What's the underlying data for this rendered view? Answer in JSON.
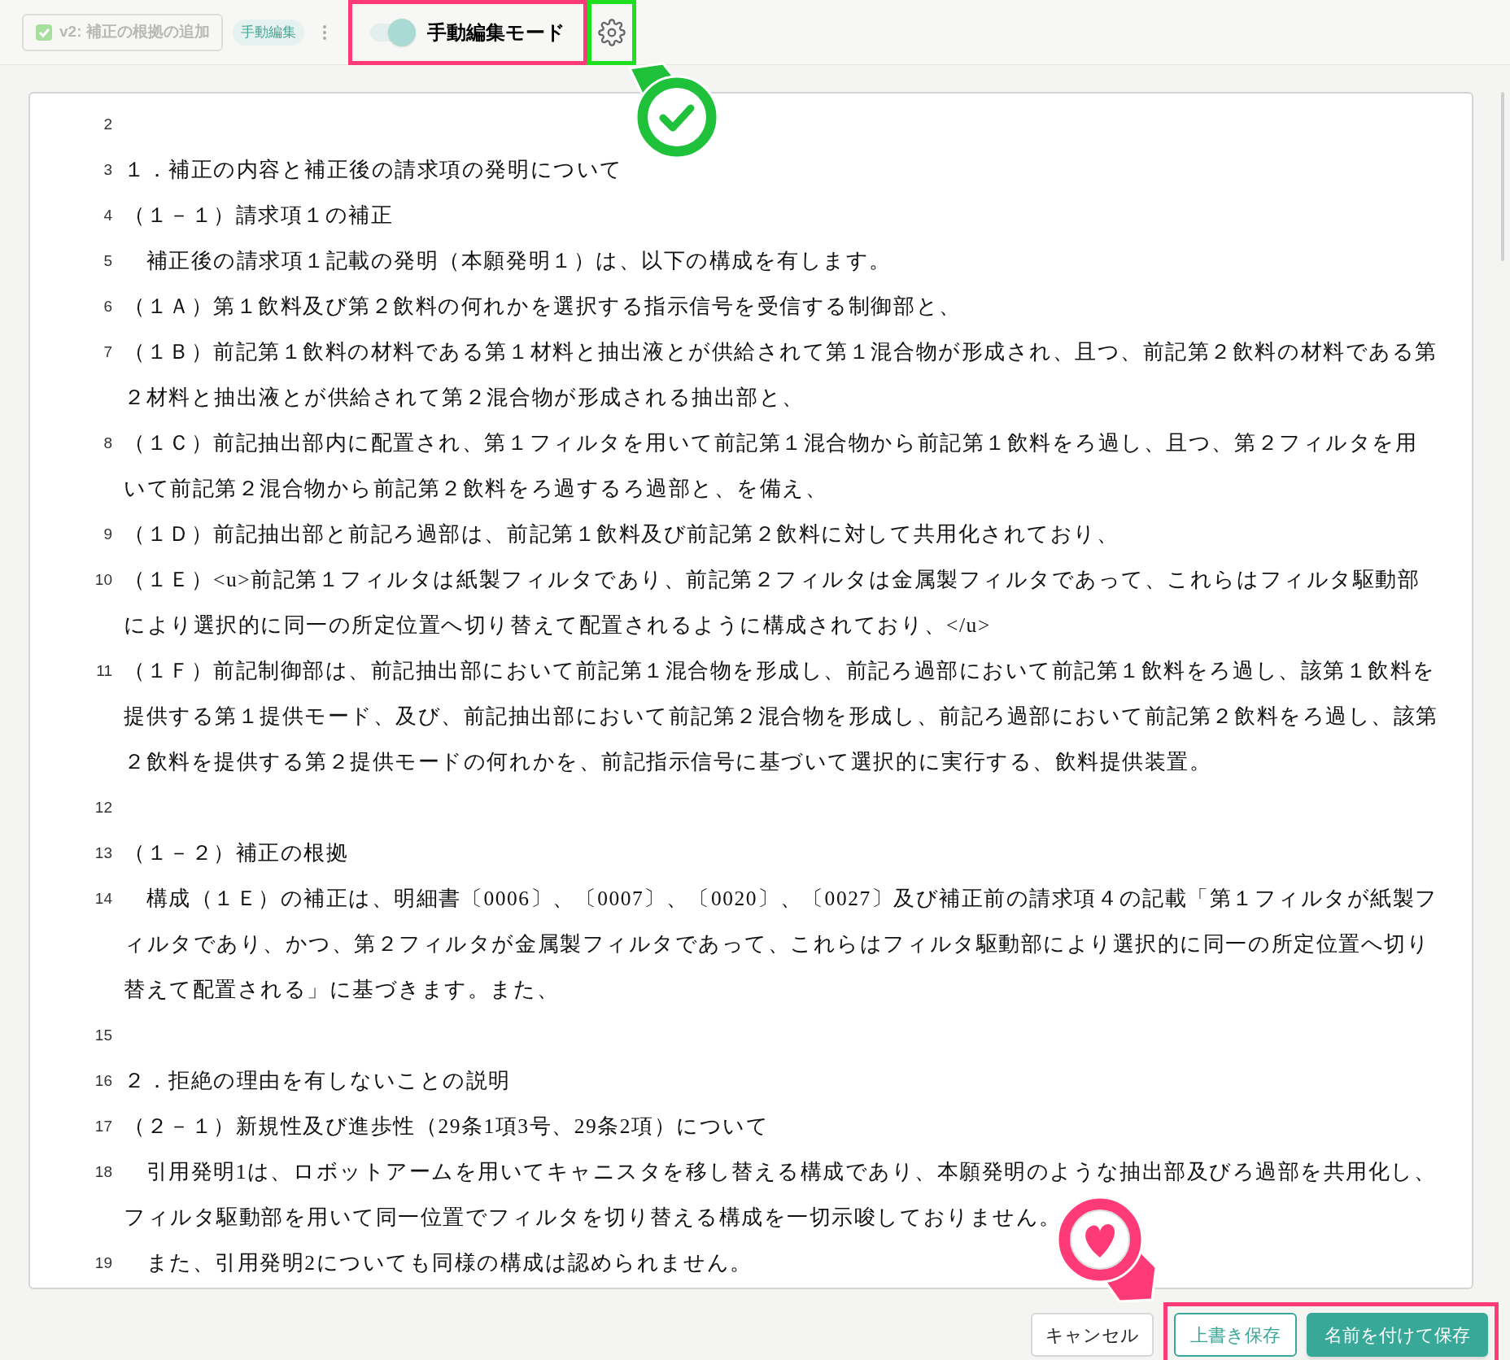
{
  "toolbar": {
    "version_chip": {
      "label": "v2: 補正の根拠の追加",
      "checked": true,
      "disabled": true
    },
    "badge": "手動編集",
    "mode_toggle": {
      "label": "手動編集モード",
      "on": true
    }
  },
  "annotations": [
    {
      "kind": "check-pin",
      "color": "#1fc13a"
    },
    {
      "kind": "heart-pin",
      "color": "#ff3a78"
    }
  ],
  "editor": {
    "lines": [
      {
        "number": "2"
      },
      {
        "number": "3",
        "text": "１．補正の内容と補正後の請求項の発明について"
      },
      {
        "number": "4",
        "text": "（１－１）請求項１の補正"
      },
      {
        "number": "5",
        "text": "　補正後の請求項１記載の発明（本願発明１）は、以下の構成を有します。"
      },
      {
        "number": "6",
        "text": "（１Ａ）第１飲料及び第２飲料の何れかを選択する指示信号を受信する制御部と、"
      },
      {
        "number": "7",
        "text": "（１Ｂ）前記第１飲料の材料である第１材料と抽出液とが供給されて第１混合物が形成され、且つ、前記第２飲料の材料である第２材料と抽出液とが供給されて第２混合物が形成される抽出部と、"
      },
      {
        "number": "8",
        "text": "（１Ｃ）前記抽出部内に配置され、第１フィルタを用いて前記第１混合物から前記第１飲料をろ過し、且つ、第２フィルタを用いて前記第２混合物から前記第２飲料をろ過するろ過部と、を備え、"
      },
      {
        "number": "9",
        "text": "（１Ｄ）前記抽出部と前記ろ過部は、前記第１飲料及び前記第２飲料に対して共用化されており、"
      },
      {
        "number": "10",
        "text": "（１Ｅ）<u>前記第１フィルタは紙製フィルタであり、前記第２フィルタは金属製フィルタであって、これらはフィルタ駆動部により選択的に同一の所定位置へ切り替えて配置されるように構成されており、</u>"
      },
      {
        "number": "11",
        "text": "（１Ｆ）前記制御部は、前記抽出部において前記第１混合物を形成し、前記ろ過部において前記第１飲料をろ過し、該第１飲料を提供する第１提供モード、及び、前記抽出部において前記第２混合物を形成し、前記ろ過部において前記第２飲料をろ過し、該第２飲料を提供する第２提供モードの何れかを、前記指示信号に基づいて選択的に実行する、飲料提供装置。"
      },
      {
        "number": "12"
      },
      {
        "number": "13",
        "text": "（１－２）補正の根拠"
      },
      {
        "number": "14",
        "text": "　構成（１Ｅ）の補正は、明細書〔0006〕、〔0007〕、〔0020〕、〔0027〕及び補正前の請求項４の記載「第１フィルタが紙製フィルタであり、かつ、第２フィルタが金属製フィルタであって、これらはフィルタ駆動部により選択的に同一の所定位置へ切り替えて配置される」に基づきます。また、"
      },
      {
        "number": "15"
      },
      {
        "number": "16",
        "text": "２．拒絶の理由を有しないことの説明"
      },
      {
        "number": "17",
        "text": "（２－１）新規性及び進歩性（29条1項3号、29条2項）について"
      },
      {
        "number": "18",
        "text": "　引用発明1は、ロボットアームを用いてキャニスタを移し替える構成であり、本願発明のような抽出部及びろ過部を共用化し、フィルタ駆動部を用いて同一位置でフィルタを切り替える構成を一切示唆しておりません。"
      },
      {
        "number": "19",
        "text": "　また、引用発明2についても同様の構成は認められません。"
      }
    ]
  },
  "footer": {
    "buttons": [
      {
        "kind": "plain",
        "label": "キャンセル"
      },
      {
        "kind": "outline",
        "label": "上書き保存"
      },
      {
        "kind": "primary",
        "label": "名前を付けて保存"
      }
    ]
  }
}
